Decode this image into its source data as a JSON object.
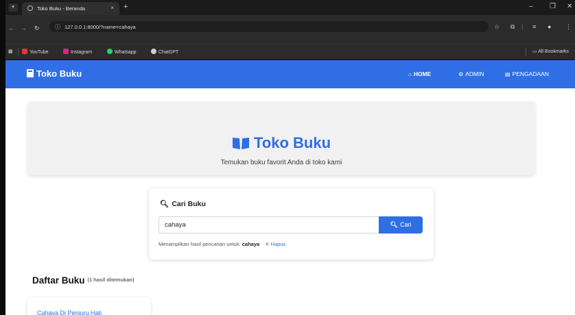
{
  "browser": {
    "tab_title": "Toko Buku - Beranda",
    "tab_close": "×",
    "new_tab": "+",
    "url": "127.0.0.1:8000/?name=cahaya",
    "bookmarks": [
      {
        "label": "YouTube",
        "color": "#e53935"
      },
      {
        "label": "Instagram",
        "color": "#d62976"
      },
      {
        "label": "Whatsapp",
        "color": "#25d366"
      },
      {
        "label": "ChatGPT",
        "color": "#cfcfcf"
      }
    ],
    "all_bookmarks": "All Bookmarks"
  },
  "navbar": {
    "brand": "Toko Buku",
    "links": [
      {
        "label": "HOME",
        "icon": "home-icon",
        "active": true
      },
      {
        "label": "ADMIN",
        "icon": "gear-icon",
        "active": false
      },
      {
        "label": "PENGADAAN",
        "icon": "clipboard-icon",
        "active": false
      }
    ],
    "color": "#2f6ee5"
  },
  "hero": {
    "title": "Toko Buku",
    "subtitle": "Temukan buku favorit Anda di toko kami"
  },
  "search": {
    "title": "Cari Buku",
    "value": "cahaya",
    "button_label": "Cari",
    "result_prefix": "Menampilkan hasil pencarian untuk:",
    "query": "cahaya",
    "clear_label": "Hapus"
  },
  "book_list": {
    "heading": "Daftar Buku",
    "count_text": "(1 hasil ditemukan)",
    "books": [
      {
        "title": "Cahaya Di Penjuru Hati"
      }
    ]
  }
}
